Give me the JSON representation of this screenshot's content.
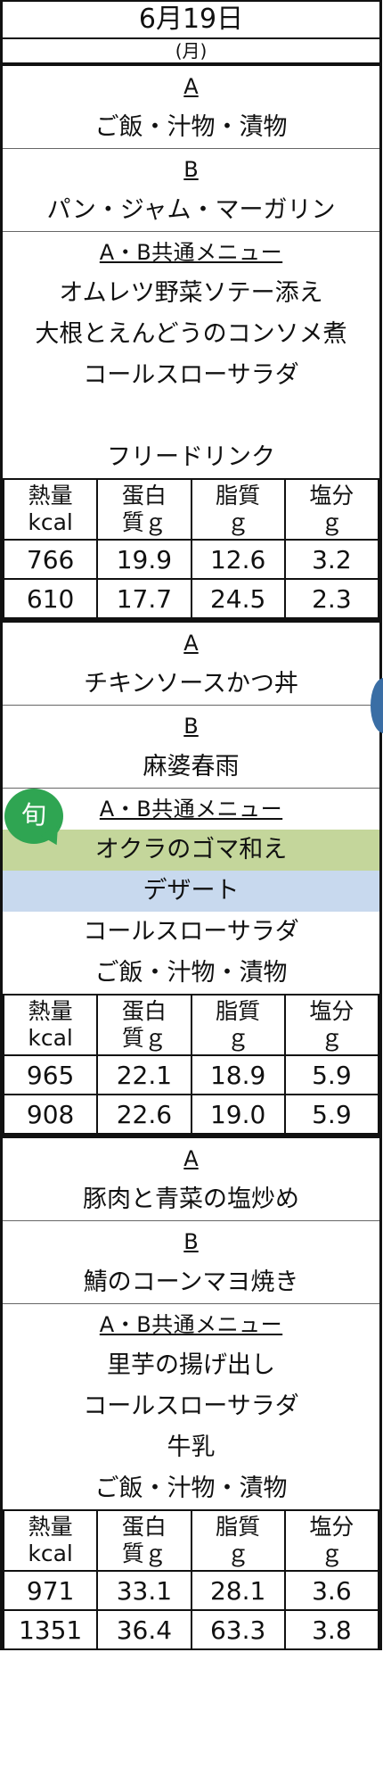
{
  "header": {
    "date": "6月19日",
    "weekday": "(月)"
  },
  "day1": {
    "a_label": "A",
    "a_item": "ご飯・汁物・漬物",
    "b_label": "B",
    "b_item": "パン・ジャム・マーガリン",
    "common_label": "A・B共通メニュー",
    "common_items": [
      "オムレツ野菜ソテー添え",
      "大根とえんどうのコンソメ煮",
      "コールスローサラダ",
      "",
      "フリードリンク"
    ],
    "nutrition_headers": [
      "熱量\nkcal",
      "蛋白\n質ｇ",
      "脂質\nｇ",
      "塩分\nｇ"
    ],
    "rows": [
      [
        "766",
        "19.9",
        "12.6",
        "3.2"
      ],
      [
        "610",
        "17.7",
        "24.5",
        "2.3"
      ]
    ]
  },
  "day2": {
    "a_label": "A",
    "a_item": "チキンソースかつ丼",
    "b_label": "B",
    "b_item": "麻婆春雨",
    "common_label": "A・B共通メニュー",
    "seasonal_badge": "旬",
    "okra": "オクラのゴマ和え",
    "dessert": "デザート",
    "common_items": [
      "コールスローサラダ",
      "ご飯・汁物・漬物"
    ],
    "rows": [
      [
        "965",
        "22.1",
        "18.9",
        "5.9"
      ],
      [
        "908",
        "22.6",
        "19.0",
        "5.9"
      ]
    ]
  },
  "day3": {
    "a_label": "A",
    "a_item": "豚肉と青菜の塩炒め",
    "b_label": "B",
    "b_item": "鯖のコーンマヨ焼き",
    "common_label": "A・B共通メニュー",
    "common_items": [
      "里芋の揚げ出し",
      "コールスローサラダ",
      "牛乳",
      "ご飯・汁物・漬物"
    ],
    "rows": [
      [
        "971",
        "33.1",
        "28.1",
        "3.6"
      ],
      [
        "1351",
        "36.4",
        "63.3",
        "3.8"
      ]
    ]
  },
  "colors": {
    "okra_bg": "#c4d69b",
    "dessert_bg": "#c8d9ee",
    "badge": "#2fa552"
  }
}
